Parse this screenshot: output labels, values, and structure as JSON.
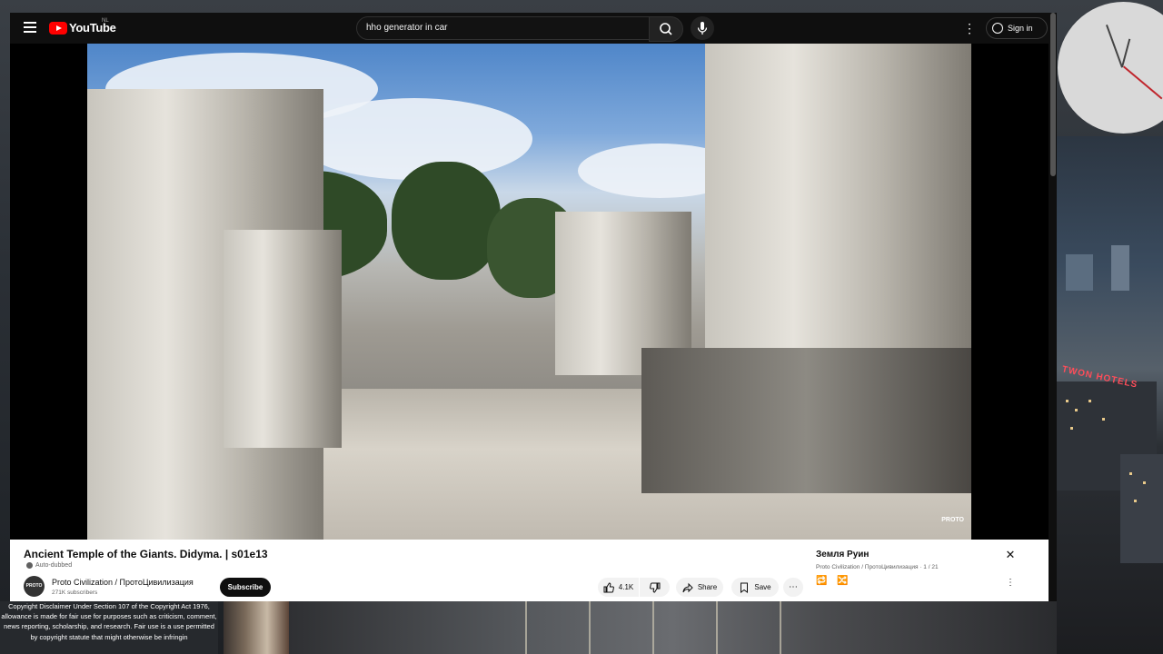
{
  "header": {
    "logo_text": "YouTube",
    "region": "NL",
    "search_value": "hho generator in car",
    "sign_in": "Sign in"
  },
  "video": {
    "watermark": "PROTO",
    "title": "Ancient Temple of the Giants. Didyma. | s01e13",
    "auto_dubbed": "Auto-dubbed"
  },
  "channel": {
    "avatar_text": "PROTO",
    "name": "Proto Civilization / ПротоЦивилизация",
    "subscribers": "271K subscribers",
    "subscribe": "Subscribe"
  },
  "actions": {
    "likes": "4.1K",
    "share": "Share",
    "save": "Save"
  },
  "playlist": {
    "title": "Земля Руин",
    "subtitle": "Proto Civilization / ПротоЦивилизация · 1 / 21"
  },
  "overlay": {
    "disclaimer": "Copyright Disclaimer Under Section 107 of the Copyright Act 1976, allowance is made for fair use for purposes such as criticism, comment, news reporting, scholarship, and research. Fair use is a use permitted by copyright statute that might otherwise be infringin",
    "hotel_sign": "TWON HOTELS"
  },
  "icons": {
    "menu": "hamburger-icon",
    "search": "search-icon",
    "mic": "microphone-icon",
    "more": "more-vert-icon",
    "account": "account-circle-icon",
    "like": "thumbs-up-icon",
    "dislike": "thumbs-down-icon",
    "share": "share-icon",
    "save": "playlist-add-icon",
    "close": "close-icon",
    "loop": "loop-icon",
    "shuffle": "shuffle-icon"
  },
  "colors": {
    "brand_red": "#ff0000",
    "dark_bg": "#0f0f0f",
    "subscribe_bg": "#0f0f0f"
  }
}
